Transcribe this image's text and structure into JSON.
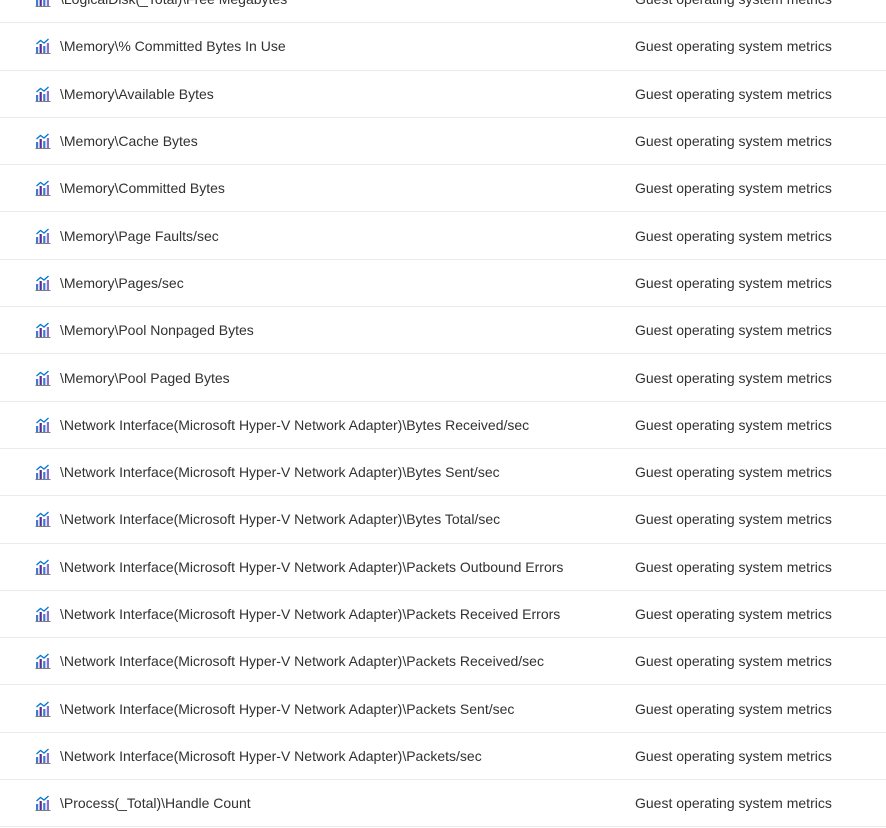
{
  "metrics": [
    {
      "name": "\\LogicalDisk(_Total)\\Free Megabytes",
      "namespace": "Guest operating system metrics"
    },
    {
      "name": "\\Memory\\% Committed Bytes In Use",
      "namespace": "Guest operating system metrics"
    },
    {
      "name": "\\Memory\\Available Bytes",
      "namespace": "Guest operating system metrics"
    },
    {
      "name": "\\Memory\\Cache Bytes",
      "namespace": "Guest operating system metrics"
    },
    {
      "name": "\\Memory\\Committed Bytes",
      "namespace": "Guest operating system metrics"
    },
    {
      "name": "\\Memory\\Page Faults/sec",
      "namespace": "Guest operating system metrics"
    },
    {
      "name": "\\Memory\\Pages/sec",
      "namespace": "Guest operating system metrics"
    },
    {
      "name": "\\Memory\\Pool Nonpaged Bytes",
      "namespace": "Guest operating system metrics"
    },
    {
      "name": "\\Memory\\Pool Paged Bytes",
      "namespace": "Guest operating system metrics"
    },
    {
      "name": "\\Network Interface(Microsoft Hyper-V Network Adapter)\\Bytes Received/sec",
      "namespace": "Guest operating system metrics"
    },
    {
      "name": "\\Network Interface(Microsoft Hyper-V Network Adapter)\\Bytes Sent/sec",
      "namespace": "Guest operating system metrics"
    },
    {
      "name": "\\Network Interface(Microsoft Hyper-V Network Adapter)\\Bytes Total/sec",
      "namespace": "Guest operating system metrics"
    },
    {
      "name": "\\Network Interface(Microsoft Hyper-V Network Adapter)\\Packets Outbound Errors",
      "namespace": "Guest operating system metrics"
    },
    {
      "name": "\\Network Interface(Microsoft Hyper-V Network Adapter)\\Packets Received Errors",
      "namespace": "Guest operating system metrics"
    },
    {
      "name": "\\Network Interface(Microsoft Hyper-V Network Adapter)\\Packets Received/sec",
      "namespace": "Guest operating system metrics"
    },
    {
      "name": "\\Network Interface(Microsoft Hyper-V Network Adapter)\\Packets Sent/sec",
      "namespace": "Guest operating system metrics"
    },
    {
      "name": "\\Network Interface(Microsoft Hyper-V Network Adapter)\\Packets/sec",
      "namespace": "Guest operating system metrics"
    },
    {
      "name": "\\Process(_Total)\\Handle Count",
      "namespace": "Guest operating system metrics"
    }
  ],
  "icon": {
    "name": "metric-chart-icon",
    "colors": {
      "bar_dark": "#5c2d91",
      "bar_light": "#8a6fd1",
      "line": "#0078d4",
      "bar_blue": "#3a7bd5"
    }
  }
}
